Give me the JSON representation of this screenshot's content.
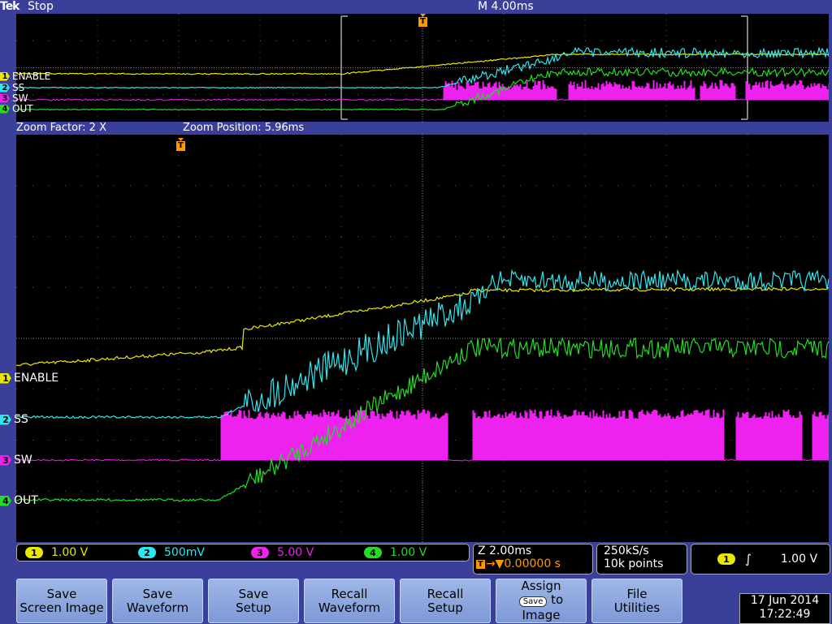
{
  "status": {
    "brand": "Tek",
    "acq_state": "Stop",
    "timebase": "M 4.00ms"
  },
  "zoom": {
    "factor": "Zoom Factor: 2 X",
    "position": "Zoom Position: 5.96ms"
  },
  "channels": [
    {
      "num": "1",
      "name": "ENABLE",
      "color": "#e8e800",
      "scale": "1.00 V"
    },
    {
      "num": "2",
      "name": "SS",
      "color": "#2ee6ee",
      "scale": "500mV"
    },
    {
      "num": "3",
      "name": "SW",
      "color": "#ee22ee",
      "scale": "5.00 V"
    },
    {
      "num": "4",
      "name": "OUT",
      "color": "#22dd22",
      "scale": "1.00 V"
    }
  ],
  "horizontal": {
    "zoom_scale": "Z 2.00ms",
    "trigger_delay": "0.00000 s"
  },
  "acquisition": {
    "sample_rate": "250kS/s",
    "record_length": "10k points"
  },
  "trigger": {
    "source": "1",
    "level": "1.00 V"
  },
  "trigger_marker": "T",
  "menu": [
    {
      "line1": "Save",
      "line2": "Screen Image"
    },
    {
      "line1": "Save",
      "line2": "Waveform"
    },
    {
      "line1": "Save",
      "line2": "Setup"
    },
    {
      "line1": "Recall",
      "line2": "Waveform"
    },
    {
      "line1": "Recall",
      "line2": "Setup"
    },
    {
      "line1": "Assign",
      "save_key": "Save",
      "line2": "to",
      "line3": "Image"
    },
    {
      "line1": "File",
      "line2": "Utilities"
    }
  ],
  "datetime": {
    "date": "17 Jun 2014",
    "time": "17:22:49"
  }
}
